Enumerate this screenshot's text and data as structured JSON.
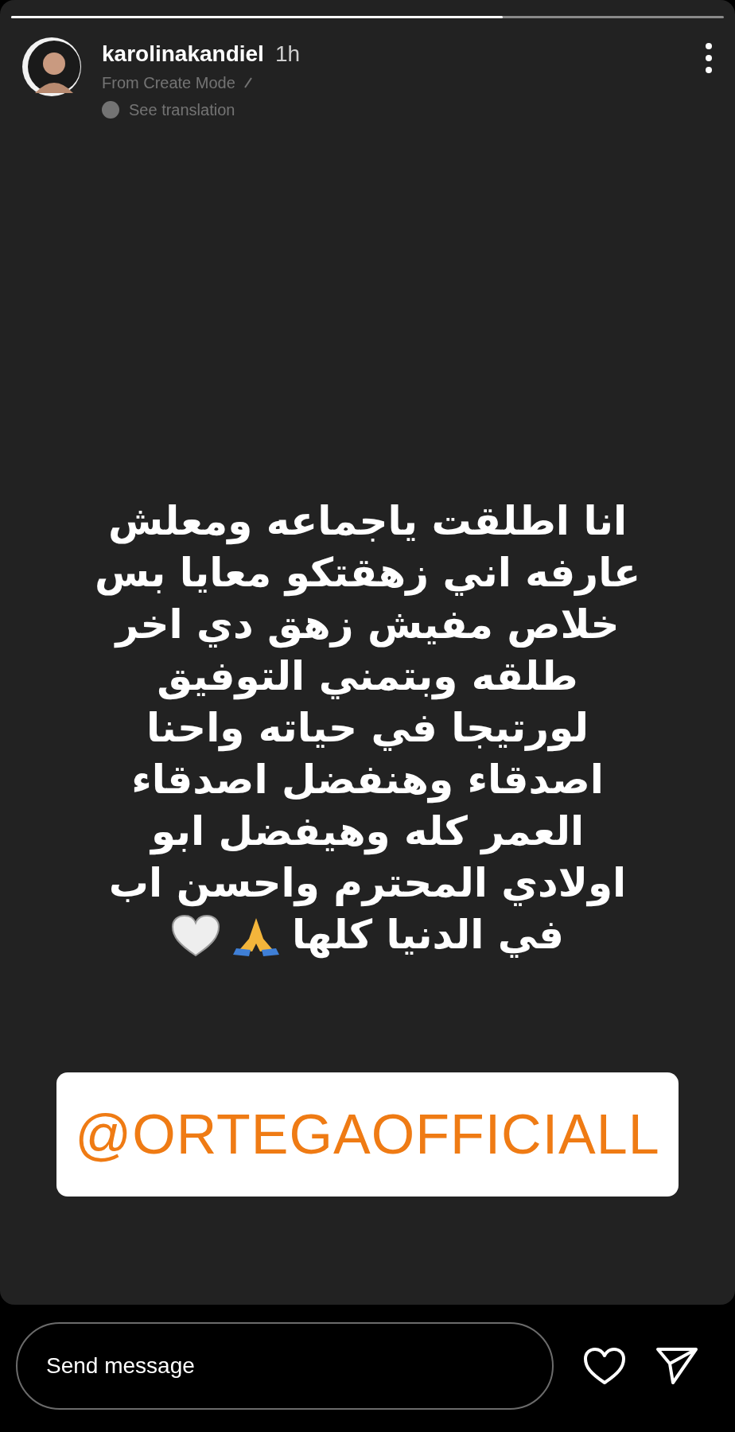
{
  "progress": {
    "level": 0.69
  },
  "header": {
    "username": "karolinakandiel",
    "time": "1h",
    "subtitle": "From Create Mode",
    "translation_link": "See translation"
  },
  "story": {
    "lines": [
      "انا اطلقت ياجماعه ومعلش",
      "عارفه اني زهقتكو معايا بس",
      "خلاص مفيش زهق دي اخر",
      "طلقه وبتمني التوفيق",
      "لورتيجا في حياته واحنا",
      "اصدقاء وهنفضل اصدقاء",
      "العمر كله وهيفضل ابو",
      "اولادي المحترم واحسن اب",
      "في الدنيا كلها"
    ],
    "mention": "@ORTEGAOFFICIALL"
  },
  "reply_bar": {
    "placeholder": "Send message"
  }
}
